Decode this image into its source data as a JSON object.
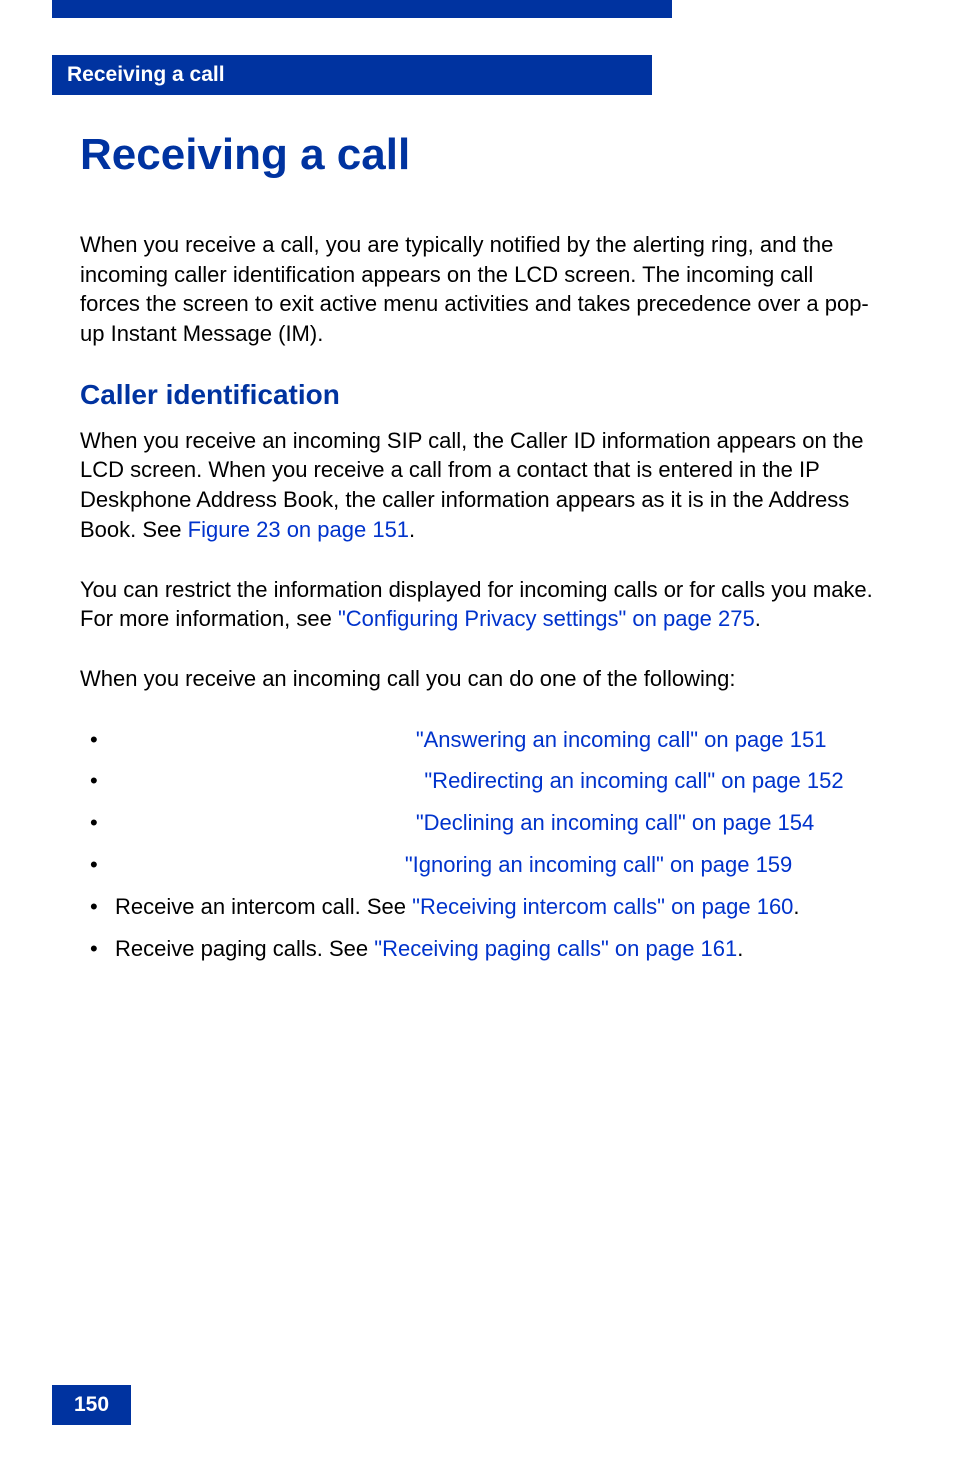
{
  "header": {
    "label": "Receiving a call"
  },
  "title": "Receiving a call",
  "intro": "When you receive a call, you are typically notified by the alerting ring, and the incoming caller identification appears on the LCD screen. The incoming call forces the screen to exit active menu activities and takes precedence over a pop-up Instant Message (IM).",
  "section": {
    "title": "Caller identification",
    "para1_pre": "When you receive an incoming SIP call, the Caller ID information appears on the LCD screen. When you receive a call from a contact that is entered in the IP Deskphone Address Book, the caller information appears as it is in the Address Book. See ",
    "para1_link": "Figure 23 on page 151",
    "para1_post": ".",
    "para2_pre": "You can restrict the information displayed for incoming calls or for calls you make. For more information, see ",
    "para2_link": "\"Configuring Privacy settings\" on page 275",
    "para2_post": ".",
    "para3": "When you receive an incoming call you can do one of the following:"
  },
  "bullets": {
    "b1_link1": "\"Answering an incoming call\" on page 151",
    "b2_link1": "\"Redirecting an incoming call\" on page 152",
    "b3_link1": "\"Declining an incoming call\" on page 154",
    "b4_link1": "\"Ignoring an incoming call\" on page 159",
    "b5_pre": "Receive an intercom call. See ",
    "b5_link": "\"Receiving intercom calls\" on page 160",
    "b5_post": ".",
    "b6_pre": "Receive paging calls. See ",
    "b6_link": "\"Receiving paging calls\" on page 161",
    "b6_post": "."
  },
  "pageNumber": "150"
}
